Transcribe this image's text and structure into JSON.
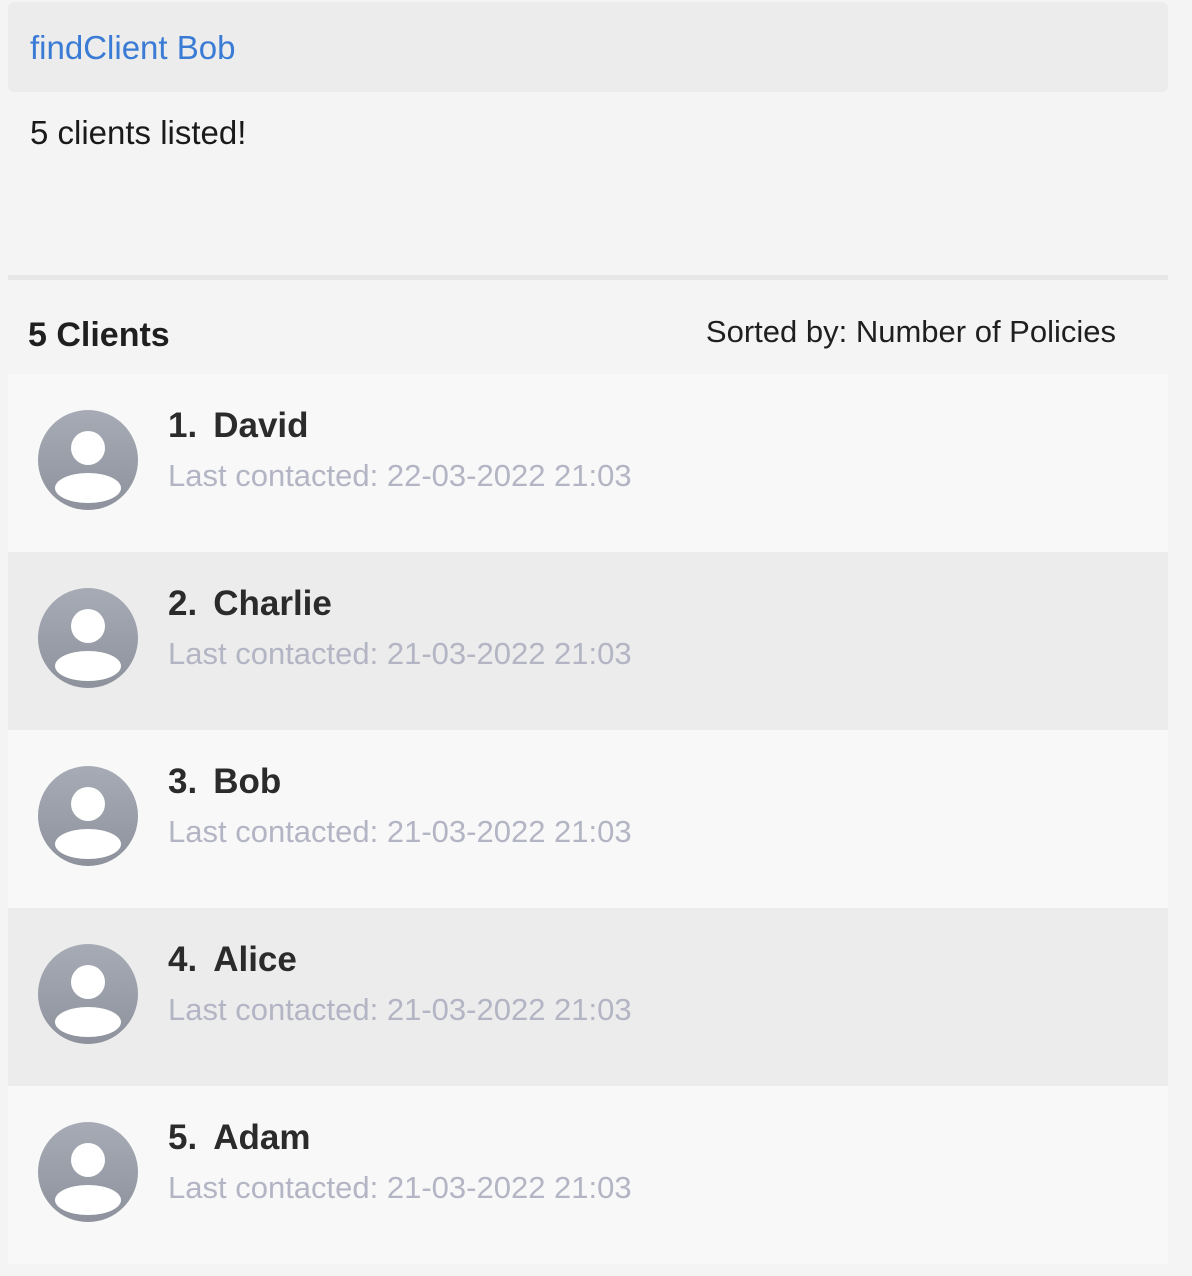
{
  "command": {
    "value": "findClient Bob"
  },
  "result": {
    "message": "5 clients listed!"
  },
  "list_header": {
    "count_label": "5 Clients",
    "sort_label": "Sorted by: Number of Policies"
  },
  "clients": [
    {
      "index": "1.",
      "name": "David",
      "last_contacted": "Last contacted: 22-03-2022 21:03"
    },
    {
      "index": "2.",
      "name": "Charlie",
      "last_contacted": "Last contacted: 21-03-2022 21:03"
    },
    {
      "index": "3.",
      "name": "Bob",
      "last_contacted": "Last contacted: 21-03-2022 21:03"
    },
    {
      "index": "4.",
      "name": "Alice",
      "last_contacted": "Last contacted: 21-03-2022 21:03"
    },
    {
      "index": "5.",
      "name": "Adam",
      "last_contacted": "Last contacted: 21-03-2022 21:03"
    }
  ],
  "icons": {
    "avatar": "user-avatar-icon"
  },
  "colors": {
    "command_text": "#3a7bd5",
    "secondary_text": "#b3b5c4",
    "alt_row": "#ececec"
  }
}
